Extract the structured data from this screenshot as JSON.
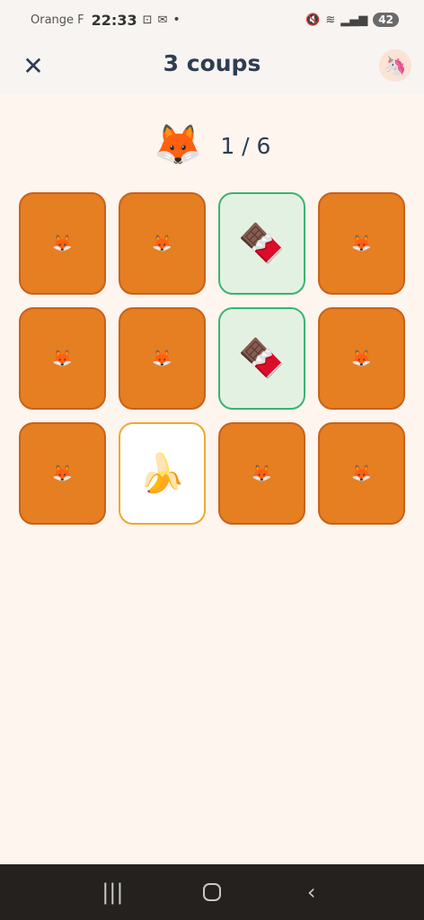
{
  "status_bar": {
    "carrier": "Orange F",
    "time": "22:33",
    "battery": "42"
  },
  "header": {
    "title": "3 coups",
    "close_icon": "✕",
    "avatar_emoji": "🦄"
  },
  "progress": {
    "mascot_emoji": "🦊",
    "text": "1 / 6"
  },
  "cards": [
    {
      "state": "hidden",
      "emoji": "🦊"
    },
    {
      "state": "hidden",
      "emoji": "🦊"
    },
    {
      "state": "matched",
      "emoji": "🍫"
    },
    {
      "state": "hidden",
      "emoji": "🦊"
    },
    {
      "state": "hidden",
      "emoji": "🦊"
    },
    {
      "state": "hidden",
      "emoji": "🦊"
    },
    {
      "state": "matched",
      "emoji": "🍫"
    },
    {
      "state": "hidden",
      "emoji": "🦊"
    },
    {
      "state": "hidden",
      "emoji": "🦊"
    },
    {
      "state": "selected",
      "emoji": "🍌"
    },
    {
      "state": "hidden",
      "emoji": "🦊"
    },
    {
      "state": "hidden",
      "emoji": "🦊"
    }
  ],
  "colors": {
    "card_back": "#e67e22",
    "matched_border": "#3cb371",
    "selected_border": "#f0a830",
    "background": "#fdf5ee"
  }
}
